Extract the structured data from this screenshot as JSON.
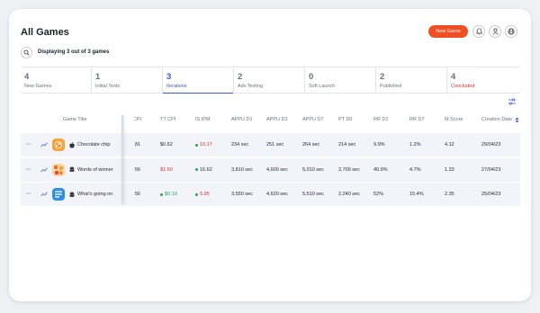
{
  "header": {
    "title": "All Games",
    "new_game_label": "New Game"
  },
  "subheader": {
    "displaying": "Displaying 3 out of 3 games"
  },
  "tabs": [
    {
      "count": "4",
      "label": "New Games"
    },
    {
      "count": "1",
      "label": "Initial Tests"
    },
    {
      "count": "3",
      "label": "Iterations"
    },
    {
      "count": "2",
      "label": "Adv.Testing"
    },
    {
      "count": "0",
      "label": "Soft Launch"
    },
    {
      "count": "2",
      "label": "Published"
    },
    {
      "count": "4",
      "label": "Concluded"
    }
  ],
  "table": {
    "headers": {
      "game_title": "Game Title",
      "cpi": "CPI",
      "tt_cpi": "TT CPI",
      "is_ipm": "IS IPM",
      "appu_d1": "APPU D1",
      "appu_d3": "APPU D3",
      "appu_d7": "APPU D7",
      "pt_d0": "PT D0",
      "rr_d1": "RR D1",
      "rr_d7": "RR D7",
      "m_score": "M.Score",
      "creation_date": "Creation Date"
    },
    "rows": [
      {
        "title": "Chocolate chip",
        "platform": "apple",
        "cpi": "81",
        "tt_cpi": "$0.62",
        "is_ipm": "10.17",
        "is_ipm_status": "red",
        "appu_d1": "234 sec",
        "appu_d3": "251 sec",
        "appu_d7": "264 sec",
        "pt_d0": "214 sec",
        "rr_d1": "9.9%",
        "rr_d7": "1.2%",
        "m_score": "4.12",
        "creation_date": "29/04/23"
      },
      {
        "title": "Words of winner",
        "platform": "android",
        "cpi": "56",
        "tt_cpi": "$1.50",
        "tt_cpi_status": "red",
        "is_ipm": "16.62",
        "is_ipm_status": "green",
        "appu_d1": "3,810 sec",
        "appu_d3": "4,600 sec",
        "appu_d7": "5,010 sec",
        "pt_d0": "2,700 sec",
        "rr_d1": "40.9%",
        "rr_d7": "4.7%",
        "m_score": "1.33",
        "creation_date": "27/04/23"
      },
      {
        "title": "What's going on",
        "platform": "android",
        "cpi": "56",
        "tt_cpi": "$0.19",
        "tt_cpi_status": "green",
        "is_ipm": "5.95",
        "is_ipm_status": "red",
        "appu_d1": "3,550 sec",
        "appu_d3": "4,620 sec",
        "appu_d7": "5,510 sec",
        "pt_d0": "2,240 sec",
        "rr_d1": "52%",
        "rr_d7": "15.4%",
        "m_score": "2.35",
        "creation_date": "25/04/23"
      }
    ]
  },
  "colors": {
    "accent": "#3d5bd8",
    "brand": "#f04e23",
    "danger": "#d9302a",
    "success": "#22a35b",
    "row_bg": "#f2f4fa"
  }
}
